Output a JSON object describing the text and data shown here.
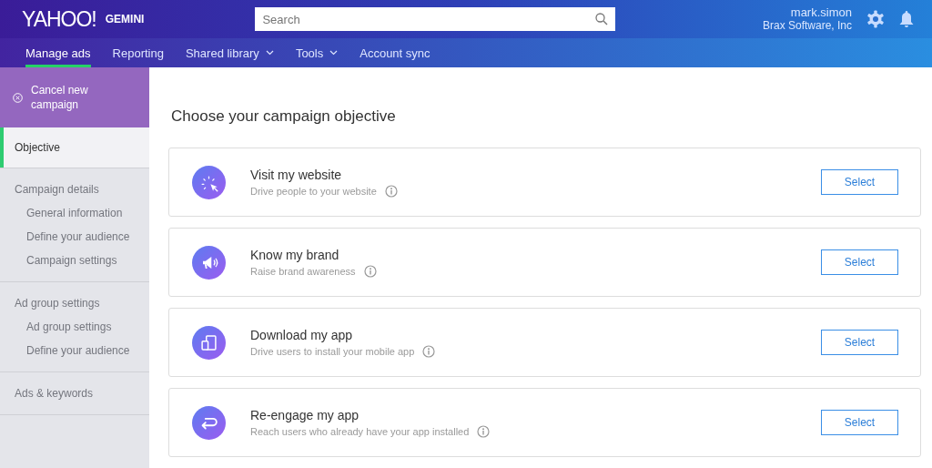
{
  "header": {
    "logo": "YAHOO!",
    "product": "GEMINI",
    "search": {
      "placeholder": "Search"
    },
    "user": {
      "name": "mark.simon",
      "company": "Brax Software, Inc"
    }
  },
  "nav": [
    {
      "label": "Manage ads",
      "selected": true,
      "dropdown": false
    },
    {
      "label": "Reporting",
      "selected": false,
      "dropdown": false
    },
    {
      "label": "Shared library",
      "selected": false,
      "dropdown": true
    },
    {
      "label": "Tools",
      "selected": false,
      "dropdown": true
    },
    {
      "label": "Account sync",
      "selected": false,
      "dropdown": false
    }
  ],
  "sidebar": {
    "cancel": "Cancel new campaign",
    "items": [
      {
        "label": "Objective",
        "selected": true,
        "disabled": false
      },
      {
        "label": "Campaign details",
        "selected": false,
        "disabled": true,
        "children": [
          {
            "label": "General information",
            "selected": false,
            "disabled": true
          },
          {
            "label": "Define your audience",
            "selected": false,
            "disabled": true
          },
          {
            "label": "Campaign settings",
            "selected": false,
            "disabled": true
          }
        ]
      },
      {
        "label": "Ad group settings",
        "selected": false,
        "disabled": true,
        "children": [
          {
            "label": "Ad group settings",
            "selected": false,
            "disabled": true
          },
          {
            "label": "Define your audience",
            "selected": false,
            "disabled": true
          }
        ]
      },
      {
        "label": "Ads & keywords",
        "selected": false,
        "disabled": true
      }
    ]
  },
  "main": {
    "title": "Choose your campaign objective",
    "objectives": [
      {
        "title": "Visit my website",
        "description": "Drive people to your website",
        "button": "Select"
      },
      {
        "title": "Know my brand",
        "description": "Raise brand awareness",
        "button": "Select"
      },
      {
        "title": "Download my app",
        "description": "Drive users to install your mobile app",
        "button": "Select"
      },
      {
        "title": "Re-engage my app",
        "description": "Reach users who already have your app installed",
        "button": "Select"
      }
    ]
  }
}
